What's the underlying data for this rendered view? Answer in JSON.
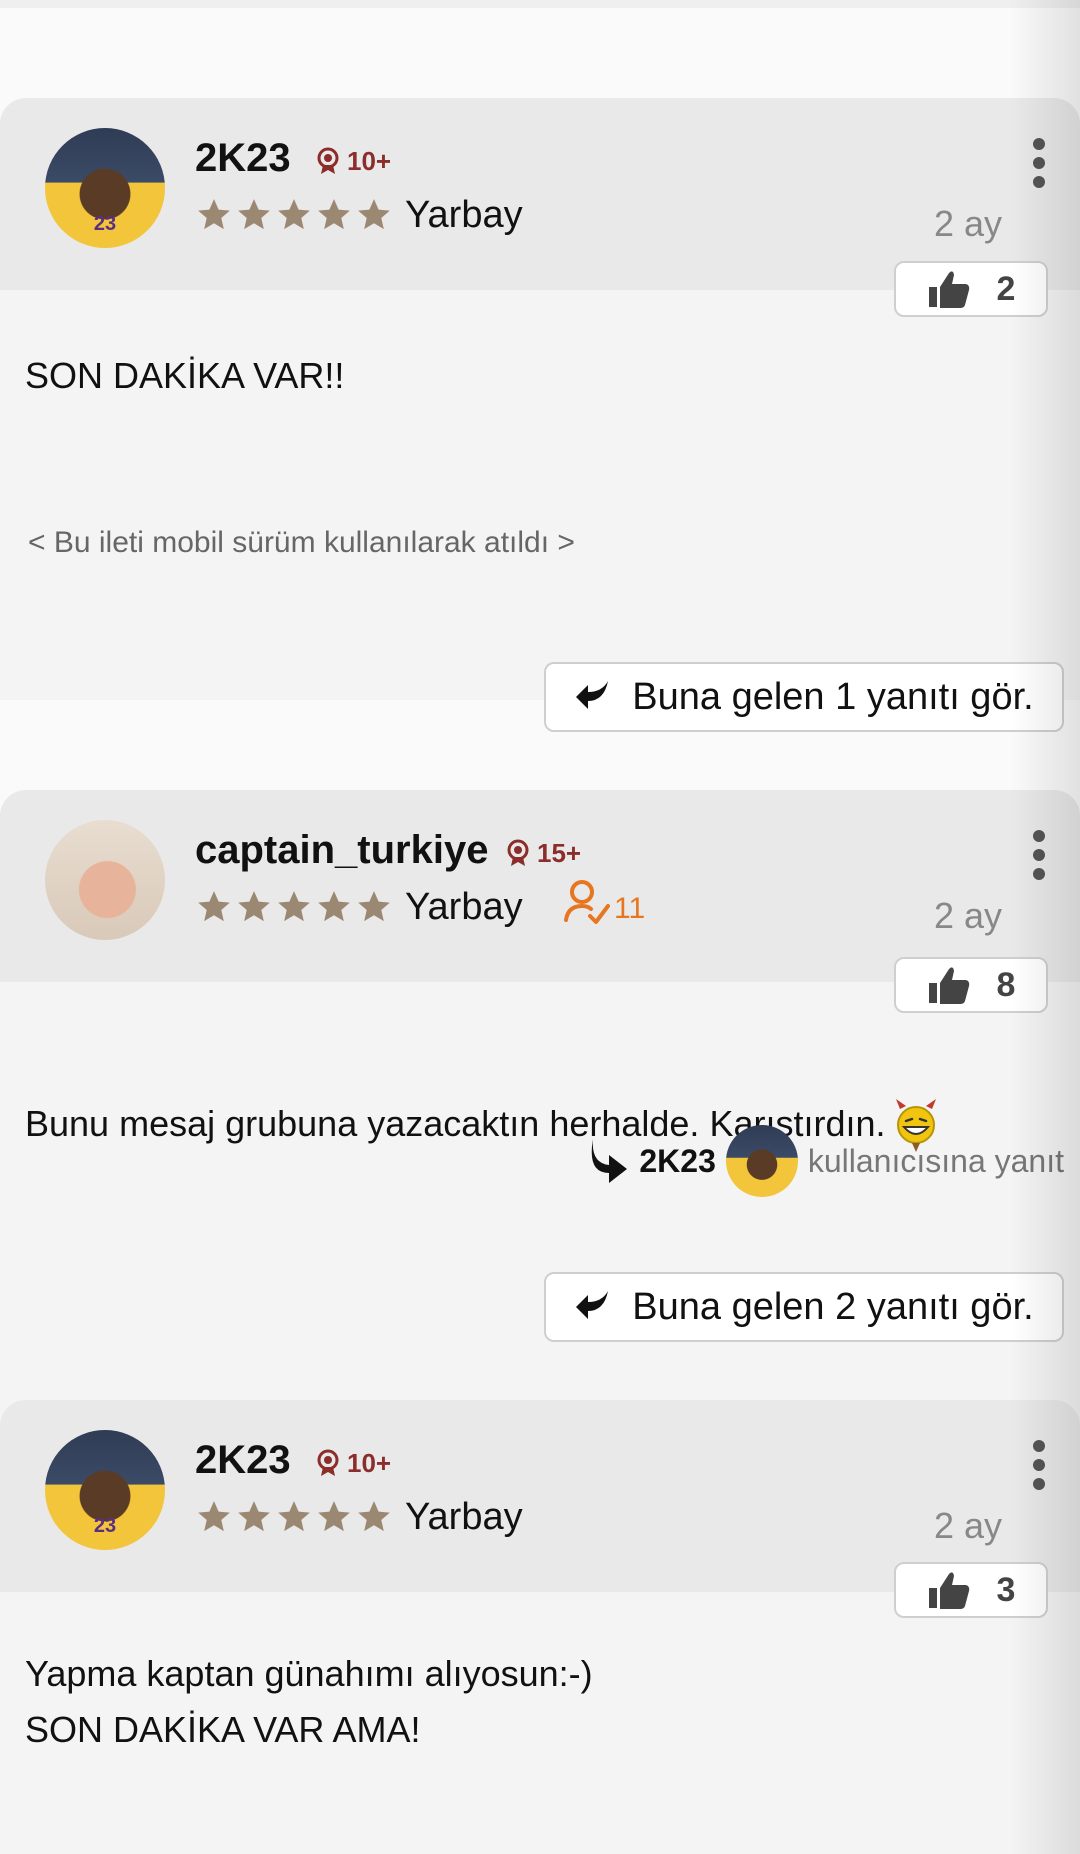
{
  "posts": [
    {
      "username": "2K23",
      "badge": "10+",
      "rank": "Yarbay",
      "time": "2 ay",
      "likes": "2",
      "message": "SON DAKİKA VAR!!",
      "mobile_note": "< Bu ileti mobil sürüm kullanılarak atıldı >",
      "replies_button": "Buna gelen 1 yanıtı gör.",
      "avatar": "lakers-player-avatar",
      "jersey": "23"
    },
    {
      "username": "captain_turkiye",
      "badge": "15+",
      "rank": "Yarbay",
      "followers": "11",
      "time": "2 ay",
      "likes": "8",
      "message": "Bunu mesaj grubuna yazacaktın herhalde. Karıştırdın.",
      "reply_to_user": "2K23",
      "reply_to_text": "kullanıcısına yanıt",
      "replies_button": "Buna gelen 2 yanıtı gör.",
      "avatar": "baby-avatar",
      "emoji": "devil-grin-emoji"
    },
    {
      "username": "2K23",
      "badge": "10+",
      "rank": "Yarbay",
      "time": "2 ay",
      "likes": "3",
      "message": "Yapma kaptan günahımı alıyosun:-)\nSON DAKİKA VAR AMA!",
      "avatar": "lakers-player-avatar",
      "jersey": "23"
    }
  ],
  "colors": {
    "badge": "#8b2d2a",
    "star": "#9b8873",
    "follower": "#e6761f",
    "header_bg": "#e9e9e9",
    "body_bg": "#f4f4f4"
  }
}
